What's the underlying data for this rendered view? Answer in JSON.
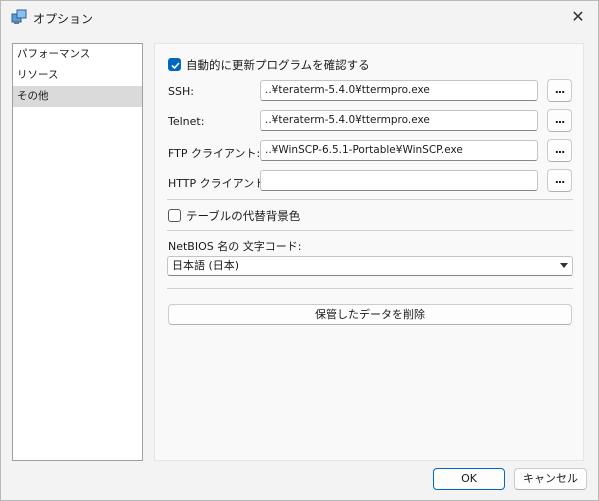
{
  "window": {
    "title": "オプション",
    "icon": "network-settings-icon",
    "close_glyph": "✕"
  },
  "nav": {
    "items": [
      {
        "label": "パフォーマンス",
        "selected": false
      },
      {
        "label": "リソース",
        "selected": false
      },
      {
        "label": "その他",
        "selected": true
      }
    ]
  },
  "panel": {
    "auto_update": {
      "label": "自動的に更新プログラムを確認する",
      "checked": true
    },
    "ssh": {
      "label": "SSH:",
      "value": "..¥teraterm-5.4.0¥ttermpro.exe",
      "browse": "..."
    },
    "telnet": {
      "label": "Telnet:",
      "value": "..¥teraterm-5.4.0¥ttermpro.exe",
      "browse": "..."
    },
    "ftp": {
      "label": "FTP クライアント:",
      "value": "..¥WinSCP-6.5.1-Portable¥WinSCP.exe",
      "browse": "..."
    },
    "http": {
      "label": "HTTP クライアント:",
      "value": "",
      "browse": "..."
    },
    "alt_bg": {
      "label": "テーブルの代替背景色",
      "checked": false
    },
    "netbios": {
      "label": "NetBIOS 名の 文字コード:",
      "selected": "日本語 (日本)"
    },
    "delete_button": "保管したデータを削除"
  },
  "footer": {
    "ok": "OK",
    "cancel": "キャンセル"
  },
  "colors": {
    "accent": "#0067c0",
    "window_bg": "#f3f3f3",
    "selected_nav": "#dadada"
  }
}
